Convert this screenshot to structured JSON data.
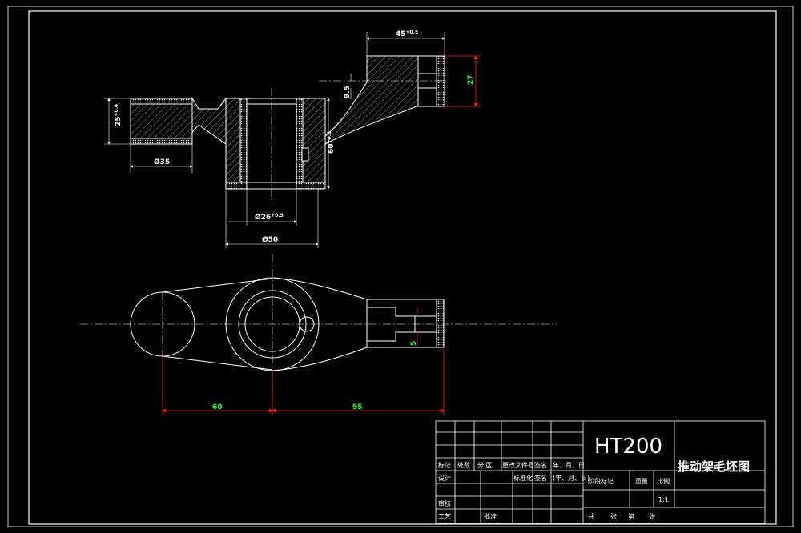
{
  "colors": {
    "background": "#000000",
    "line": "#ffffff",
    "dimension": "#ff2020",
    "dimension_text": "#22ff22",
    "hatch": "#ffffff"
  },
  "dimensions": {
    "width_45": "45",
    "width_45_tol": "+0.5",
    "height_27": "27",
    "offset_9_5": "9.5",
    "height_25": "25",
    "height_25_tol": "+0.4",
    "dia_35": "Ø35",
    "dia_26": "Ø26",
    "dia_26_tol": "+0.5",
    "dia_50": "Ø50",
    "height_60": "60",
    "height_60_tol": "+0.8",
    "slot_5": "5",
    "len_60": "60",
    "len_95": "95"
  },
  "title_block": {
    "material": "HT200",
    "drawing_title": "推动架毛坯图",
    "row_labels": [
      "标记",
      "处数",
      "分 区",
      "更改文件号",
      "签名",
      "年、月、日"
    ],
    "design": "设计",
    "standardize": "标准化",
    "sign": "签名",
    "date": "(年、月、日)",
    "review": "审核",
    "process": "工艺",
    "approve": "批准",
    "stage_mark": "阶段标记",
    "weight": "重量",
    "scale_label": "比例",
    "scale_value": "1:1",
    "sheets_total": "共",
    "sheets_unit": "张",
    "sheet_no": "第",
    "sheet_unit2": "张"
  }
}
